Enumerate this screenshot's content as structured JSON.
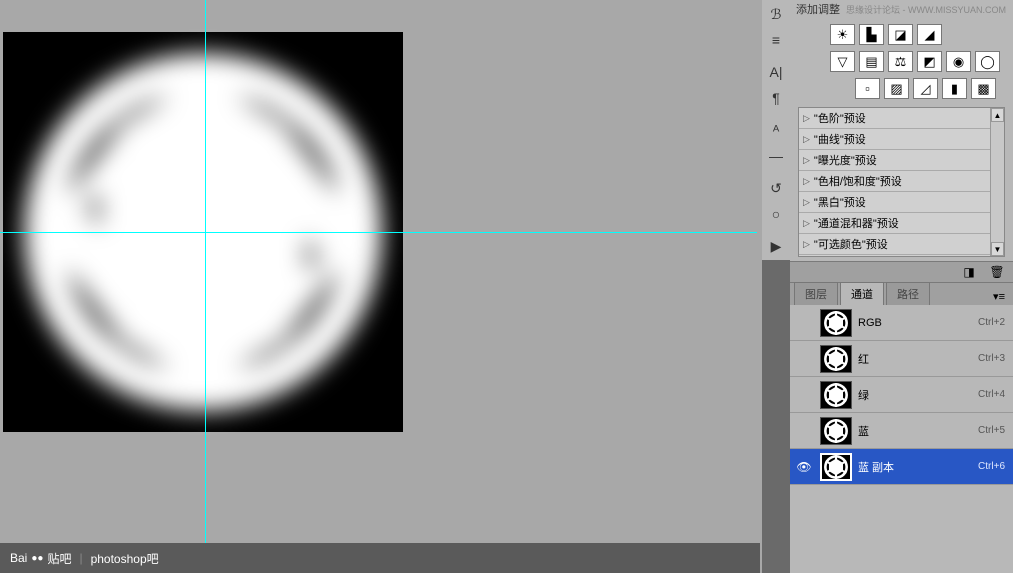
{
  "header": {
    "title": "添加调整",
    "watermark": "思缘设计论坛 - WWW.MISSYUAN.COM"
  },
  "adjustments": {
    "row1": [
      "☀",
      "▙",
      "◪",
      "◢"
    ],
    "row2": [
      "▽",
      "▤",
      "⚖",
      "◩",
      "◉",
      "◯"
    ],
    "row3": [
      "▫",
      "▨",
      "◿",
      "▮",
      "▩"
    ]
  },
  "presets": [
    "\"色阶\"预设",
    "\"曲线\"预设",
    "\"曝光度\"预设",
    "\"色相/饱和度\"预设",
    "\"黑白\"预设",
    "\"通道混和器\"预设",
    "\"可选颜色\"预设"
  ],
  "tabs": {
    "layers": "图层",
    "channels": "通道",
    "paths": "路径"
  },
  "channels": [
    {
      "name": "RGB",
      "shortcut": "Ctrl+2",
      "eye": false
    },
    {
      "name": "红",
      "shortcut": "Ctrl+3",
      "eye": false
    },
    {
      "name": "绿",
      "shortcut": "Ctrl+4",
      "eye": false
    },
    {
      "name": "蓝",
      "shortcut": "Ctrl+5",
      "eye": false
    },
    {
      "name": "蓝 副本",
      "shortcut": "Ctrl+6",
      "eye": true,
      "selected": true
    }
  ],
  "tool_strip": [
    "ℬ",
    "≡",
    "A|",
    "¶",
    "ᴬ",
    "—",
    "↺",
    "○",
    "▶"
  ],
  "footer": {
    "brand": "Bai",
    "brand2": "贴吧",
    "sub": "photoshop吧"
  }
}
